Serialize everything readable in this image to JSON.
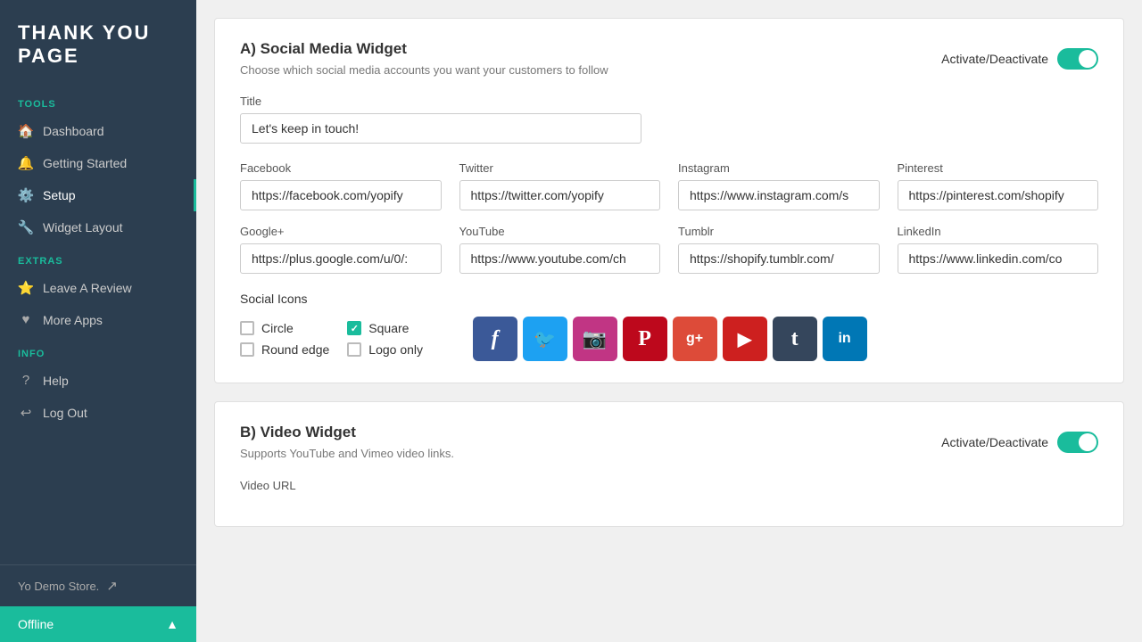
{
  "sidebar": {
    "logo": "THANK YOU PAGE",
    "sections": {
      "tools": {
        "label": "Tools",
        "items": [
          {
            "id": "dashboard",
            "label": "Dashboard",
            "icon": "🏠"
          },
          {
            "id": "getting-started",
            "label": "Getting Started",
            "icon": "🔔"
          },
          {
            "id": "setup",
            "label": "Setup",
            "icon": "⚙️",
            "active": true
          },
          {
            "id": "widget-layout",
            "label": "Widget Layout",
            "icon": "🔧"
          }
        ]
      },
      "extras": {
        "label": "Extras",
        "items": [
          {
            "id": "leave-a-review",
            "label": "Leave A Review",
            "icon": "⭐"
          },
          {
            "id": "more-apps",
            "label": "More Apps",
            "icon": "♥"
          }
        ]
      },
      "info": {
        "label": "Info",
        "items": [
          {
            "id": "help",
            "label": "Help",
            "icon": "?"
          },
          {
            "id": "log-out",
            "label": "Log Out",
            "icon": "↩"
          }
        ]
      }
    },
    "store_name": "Yo Demo Store.",
    "external_icon": "↗",
    "offline_label": "Offline",
    "chevron": "▲"
  },
  "social_widget": {
    "section_id": "A",
    "title": "A) Social Media Widget",
    "description": "Choose which social media accounts you want your customers to follow",
    "activate_label": "Activate/Deactivate",
    "toggle_on": true,
    "fields": {
      "title_label": "Title",
      "title_value": "Let's keep in touch!",
      "facebook_label": "Facebook",
      "facebook_value": "https://facebook.com/yopify",
      "twitter_label": "Twitter",
      "twitter_value": "https://twitter.com/yopify",
      "instagram_label": "Instagram",
      "instagram_value": "https://www.instagram.com/s",
      "pinterest_label": "Pinterest",
      "pinterest_value": "https://pinterest.com/shopify",
      "google_label": "Google+",
      "google_value": "https://plus.google.com/u/0/:",
      "youtube_label": "YouTube",
      "youtube_value": "https://www.youtube.com/ch",
      "tumblr_label": "Tumblr",
      "tumblr_value": "https://shopify.tumblr.com/",
      "linkedin_label": "LinkedIn",
      "linkedin_value": "https://www.linkedin.com/co"
    },
    "social_icons_label": "Social Icons",
    "icon_options": [
      {
        "id": "circle",
        "label": "Circle",
        "checked": false
      },
      {
        "id": "square",
        "label": "Square",
        "checked": true
      },
      {
        "id": "round-edge",
        "label": "Round edge",
        "checked": false
      },
      {
        "id": "logo-only",
        "label": "Logo only",
        "checked": false
      }
    ],
    "icons": [
      {
        "id": "facebook",
        "symbol": "f",
        "css_class": "si-facebook"
      },
      {
        "id": "twitter",
        "symbol": "🐦",
        "css_class": "si-twitter"
      },
      {
        "id": "instagram",
        "symbol": "📷",
        "css_class": "si-instagram"
      },
      {
        "id": "pinterest",
        "symbol": "P",
        "css_class": "si-pinterest"
      },
      {
        "id": "google",
        "symbol": "g+",
        "css_class": "si-google"
      },
      {
        "id": "youtube",
        "symbol": "▶",
        "css_class": "si-youtube"
      },
      {
        "id": "tumblr",
        "symbol": "t",
        "css_class": "si-tumblr"
      },
      {
        "id": "linkedin",
        "symbol": "in",
        "css_class": "si-linkedin"
      }
    ]
  },
  "video_widget": {
    "title": "B) Video Widget",
    "description": "Supports YouTube and Vimeo video links.",
    "activate_label": "Activate/Deactivate",
    "toggle_on": true,
    "video_url_label": "Video URL"
  }
}
